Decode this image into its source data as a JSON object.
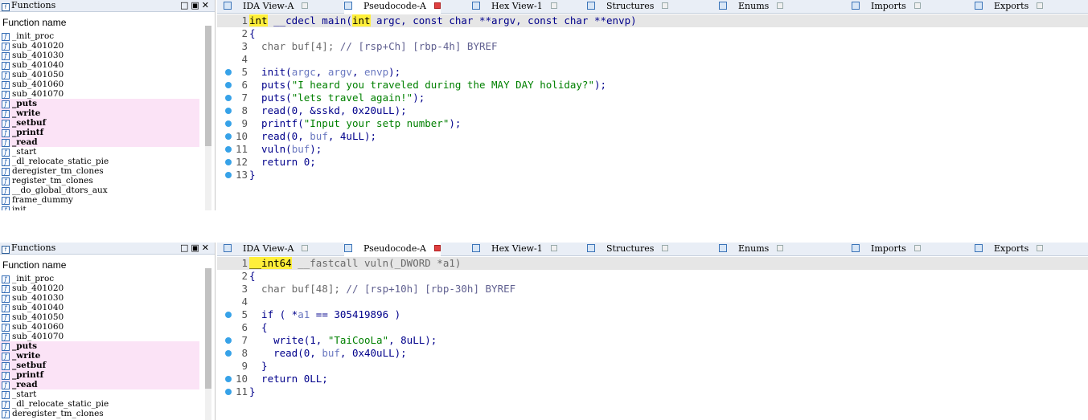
{
  "windows": [
    {
      "functions_panel": {
        "title": "Functions",
        "header": "Function name",
        "items": [
          {
            "name": "_init_proc",
            "pink": false,
            "bold": false
          },
          {
            "name": "sub_401020",
            "pink": false,
            "bold": false
          },
          {
            "name": "sub_401030",
            "pink": false,
            "bold": false
          },
          {
            "name": "sub_401040",
            "pink": false,
            "bold": false
          },
          {
            "name": "sub_401050",
            "pink": false,
            "bold": false
          },
          {
            "name": "sub_401060",
            "pink": false,
            "bold": false
          },
          {
            "name": "sub_401070",
            "pink": false,
            "bold": false
          },
          {
            "name": "_puts",
            "pink": true,
            "bold": true
          },
          {
            "name": "_write",
            "pink": true,
            "bold": true
          },
          {
            "name": "_setbuf",
            "pink": true,
            "bold": true
          },
          {
            "name": "_printf",
            "pink": true,
            "bold": true
          },
          {
            "name": "_read",
            "pink": true,
            "bold": true
          },
          {
            "name": "_start",
            "pink": false,
            "bold": false
          },
          {
            "name": "_dl_relocate_static_pie",
            "pink": false,
            "bold": false
          },
          {
            "name": "deregister_tm_clones",
            "pink": false,
            "bold": false
          },
          {
            "name": "register_tm_clones",
            "pink": false,
            "bold": false
          },
          {
            "name": "__do_global_dtors_aux",
            "pink": false,
            "bold": false
          },
          {
            "name": "frame_dummy",
            "pink": false,
            "bold": false
          },
          {
            "name": "init",
            "pink": false,
            "bold": false
          }
        ]
      },
      "tabs": [
        {
          "label": "IDA View-A",
          "active": false,
          "red_close": false
        },
        {
          "label": "Pseudocode-A",
          "active": true,
          "red_close": true
        },
        {
          "label": "Hex View-1",
          "active": false,
          "red_close": false
        },
        {
          "label": "Structures",
          "active": false,
          "red_close": false
        },
        {
          "label": "Enums",
          "active": false,
          "red_close": false
        },
        {
          "label": "Imports",
          "active": false,
          "red_close": false
        },
        {
          "label": "Exports",
          "active": false,
          "red_close": false
        }
      ],
      "code_lines": [
        {
          "num": "1",
          "dot": false,
          "current": true,
          "tokens": [
            {
              "t": "int",
              "c": "hl"
            },
            {
              "t": " __cdecl main(",
              "c": "kw"
            },
            {
              "t": "int",
              "c": "hl"
            },
            {
              "t": " argc, const char **argv, const char **envp)",
              "c": "kw"
            }
          ]
        },
        {
          "num": "2",
          "dot": false,
          "current": false,
          "tokens": [
            {
              "t": "{",
              "c": "kw"
            }
          ]
        },
        {
          "num": "3",
          "dot": false,
          "current": false,
          "tokens": [
            {
              "t": "  char buf[4]; ",
              "c": "gray"
            },
            {
              "t": "// [rsp+Ch] [rbp-4h] BYREF",
              "c": "cmt"
            }
          ]
        },
        {
          "num": "4",
          "dot": false,
          "current": false,
          "tokens": []
        },
        {
          "num": "5",
          "dot": true,
          "current": false,
          "tokens": [
            {
              "t": "  init(",
              "c": "kw"
            },
            {
              "t": "argc",
              "c": "var"
            },
            {
              "t": ", ",
              "c": "kw"
            },
            {
              "t": "argv",
              "c": "var"
            },
            {
              "t": ", ",
              "c": "kw"
            },
            {
              "t": "envp",
              "c": "var"
            },
            {
              "t": ");",
              "c": "kw"
            }
          ]
        },
        {
          "num": "6",
          "dot": true,
          "current": false,
          "tokens": [
            {
              "t": "  puts(",
              "c": "kw"
            },
            {
              "t": "\"I heard you traveled during the MAY DAY holiday?\"",
              "c": "str"
            },
            {
              "t": ");",
              "c": "kw"
            }
          ]
        },
        {
          "num": "7",
          "dot": true,
          "current": false,
          "tokens": [
            {
              "t": "  puts(",
              "c": "kw"
            },
            {
              "t": "\"lets travel again!\"",
              "c": "str"
            },
            {
              "t": ");",
              "c": "kw"
            }
          ]
        },
        {
          "num": "8",
          "dot": true,
          "current": false,
          "tokens": [
            {
              "t": "  read(0, &sskd, 0x20uLL);",
              "c": "kw"
            }
          ]
        },
        {
          "num": "9",
          "dot": true,
          "current": false,
          "tokens": [
            {
              "t": "  printf(",
              "c": "kw"
            },
            {
              "t": "\"Input your setp number\"",
              "c": "str"
            },
            {
              "t": ");",
              "c": "kw"
            }
          ]
        },
        {
          "num": "10",
          "dot": true,
          "current": false,
          "tokens": [
            {
              "t": "  read(0, ",
              "c": "kw"
            },
            {
              "t": "buf",
              "c": "var"
            },
            {
              "t": ", 4uLL);",
              "c": "kw"
            }
          ]
        },
        {
          "num": "11",
          "dot": true,
          "current": false,
          "tokens": [
            {
              "t": "  vuln(",
              "c": "kw"
            },
            {
              "t": "buf",
              "c": "var"
            },
            {
              "t": ");",
              "c": "kw"
            }
          ]
        },
        {
          "num": "12",
          "dot": true,
          "current": false,
          "tokens": [
            {
              "t": "  return 0;",
              "c": "kw"
            }
          ]
        },
        {
          "num": "13",
          "dot": true,
          "current": false,
          "tokens": [
            {
              "t": "}",
              "c": "kw"
            }
          ]
        }
      ]
    },
    {
      "functions_panel": {
        "title": "Functions",
        "header": "Function name",
        "items": [
          {
            "name": "_init_proc",
            "pink": false,
            "bold": false
          },
          {
            "name": "sub_401020",
            "pink": false,
            "bold": false
          },
          {
            "name": "sub_401030",
            "pink": false,
            "bold": false
          },
          {
            "name": "sub_401040",
            "pink": false,
            "bold": false
          },
          {
            "name": "sub_401050",
            "pink": false,
            "bold": false
          },
          {
            "name": "sub_401060",
            "pink": false,
            "bold": false
          },
          {
            "name": "sub_401070",
            "pink": false,
            "bold": false
          },
          {
            "name": "_puts",
            "pink": true,
            "bold": true
          },
          {
            "name": "_write",
            "pink": true,
            "bold": true
          },
          {
            "name": "_setbuf",
            "pink": true,
            "bold": true
          },
          {
            "name": "_printf",
            "pink": true,
            "bold": true
          },
          {
            "name": "_read",
            "pink": true,
            "bold": true
          },
          {
            "name": "_start",
            "pink": false,
            "bold": false
          },
          {
            "name": "_dl_relocate_static_pie",
            "pink": false,
            "bold": false
          },
          {
            "name": "deregister_tm_clones",
            "pink": false,
            "bold": false
          }
        ]
      },
      "tabs": [
        {
          "label": "IDA View-A",
          "active": false,
          "red_close": false
        },
        {
          "label": "Pseudocode-A",
          "active": true,
          "red_close": true
        },
        {
          "label": "Hex View-1",
          "active": false,
          "red_close": false
        },
        {
          "label": "Structures",
          "active": false,
          "red_close": false
        },
        {
          "label": "Enums",
          "active": false,
          "red_close": false
        },
        {
          "label": "Imports",
          "active": false,
          "red_close": false
        },
        {
          "label": "Exports",
          "active": false,
          "red_close": false
        }
      ],
      "code_lines": [
        {
          "num": "1",
          "dot": false,
          "current": true,
          "tokens": [
            {
              "t": "__int64",
              "c": "hl"
            },
            {
              "t": " __fastcall vuln(_DWORD *a1)",
              "c": "gray"
            }
          ]
        },
        {
          "num": "2",
          "dot": false,
          "current": false,
          "tokens": [
            {
              "t": "{",
              "c": "kw"
            }
          ]
        },
        {
          "num": "3",
          "dot": false,
          "current": false,
          "tokens": [
            {
              "t": "  char buf[48]; ",
              "c": "gray"
            },
            {
              "t": "// [rsp+10h] [rbp-30h] BYREF",
              "c": "cmt"
            }
          ]
        },
        {
          "num": "4",
          "dot": false,
          "current": false,
          "tokens": []
        },
        {
          "num": "5",
          "dot": true,
          "current": false,
          "tokens": [
            {
              "t": "  if ( *",
              "c": "kw"
            },
            {
              "t": "a1",
              "c": "var"
            },
            {
              "t": " == 305419896 )",
              "c": "kw"
            }
          ]
        },
        {
          "num": "6",
          "dot": false,
          "current": false,
          "tokens": [
            {
              "t": "  {",
              "c": "kw"
            }
          ]
        },
        {
          "num": "7",
          "dot": true,
          "current": false,
          "tokens": [
            {
              "t": "    write(1, ",
              "c": "kw"
            },
            {
              "t": "\"TaiCooLa\"",
              "c": "str"
            },
            {
              "t": ", 8uLL);",
              "c": "kw"
            }
          ]
        },
        {
          "num": "8",
          "dot": true,
          "current": false,
          "tokens": [
            {
              "t": "    read(0, ",
              "c": "kw"
            },
            {
              "t": "buf",
              "c": "var"
            },
            {
              "t": ", 0x40uLL);",
              "c": "kw"
            }
          ]
        },
        {
          "num": "9",
          "dot": false,
          "current": false,
          "tokens": [
            {
              "t": "  }",
              "c": "kw"
            }
          ]
        },
        {
          "num": "10",
          "dot": true,
          "current": false,
          "tokens": [
            {
              "t": "  return 0LL;",
              "c": "kw"
            }
          ]
        },
        {
          "num": "11",
          "dot": true,
          "current": false,
          "tokens": [
            {
              "t": "}",
              "c": "kw"
            }
          ]
        }
      ]
    }
  ]
}
